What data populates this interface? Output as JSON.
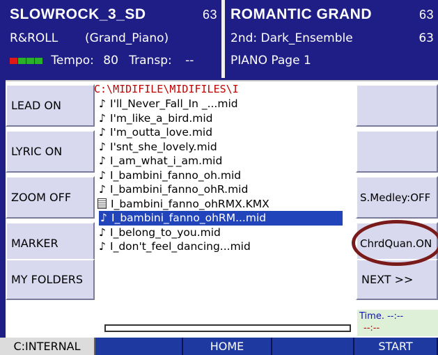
{
  "left_panel": {
    "style_name": "SLOWROCK_3_SD",
    "style_number": "63",
    "category": "R&ROLL",
    "instrument": "(Grand_Piano)",
    "tempo_label": "Tempo:",
    "tempo_value": "80",
    "transp_label": "Transp:",
    "transp_value": "--"
  },
  "right_panel": {
    "sound_name": "ROMANTIC GRAND",
    "sound_number": "63",
    "second_sound": "2nd: Dark_Ensemble",
    "second_number": "63",
    "page": "PIANO Page  1"
  },
  "left_buttons": [
    "LEAD ON",
    "LYRIC ON",
    "ZOOM OFF",
    "MARKER",
    "MY FOLDERS"
  ],
  "right_buttons": [
    "",
    "",
    "S.Medley:OFF",
    "ChrdQuan.ON",
    "NEXT >>"
  ],
  "path": "C:\\MIDIFILE\\MIDIFILES\\I",
  "files": [
    {
      "name": "I'll_Never_Fall_In _...mid",
      "icon": "note-icon"
    },
    {
      "name": "I'm_like_a_bird.mid",
      "icon": "note-icon"
    },
    {
      "name": "I'm_outta_love.mid",
      "icon": "note-icon"
    },
    {
      "name": "I'snt_she_lovely.mid",
      "icon": "note-icon"
    },
    {
      "name": "I_am_what_i_am.mid",
      "icon": "note-icon"
    },
    {
      "name": "I_bambini_fanno_oh.mid",
      "icon": "note-icon"
    },
    {
      "name": "I_bambini_fanno_ohR.mid",
      "icon": "note-icon"
    },
    {
      "name": "I_bambini_fanno_ohRMX.KMX",
      "icon": "document-icon"
    },
    {
      "name": "I_bambini_fanno_ohRM...mid",
      "icon": "note-icon",
      "selected": true
    },
    {
      "name": "I_belong_to_you.mid",
      "icon": "note-icon"
    },
    {
      "name": "I_don't_feel_dancing...mid",
      "icon": "note-icon"
    }
  ],
  "time": {
    "label": "Time. --:--",
    "sub": "--:--"
  },
  "bottom_bar": [
    "C:INTERNAL",
    "",
    "HOME",
    "",
    "START"
  ],
  "colors": {
    "background": "#1e1e86",
    "selection": "#2244bb",
    "path": "#c00000",
    "ring": "#7a1b1b"
  }
}
